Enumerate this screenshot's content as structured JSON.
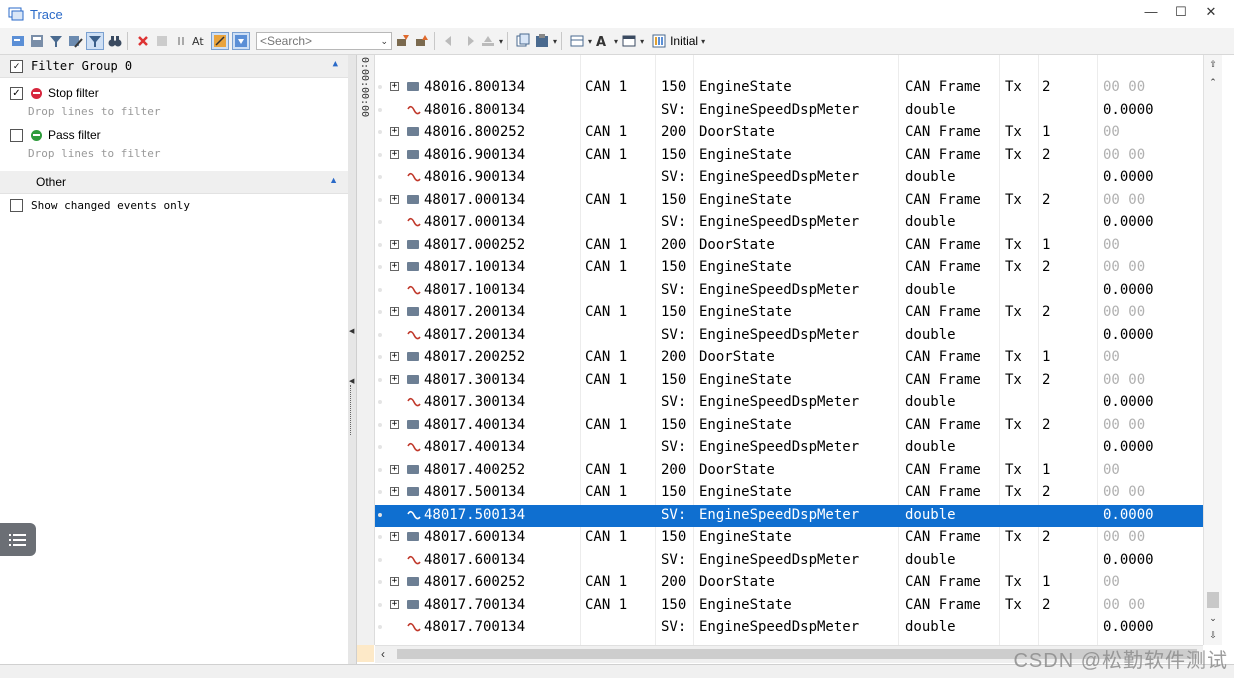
{
  "window": {
    "title": "Trace",
    "controls": [
      "—",
      "☐",
      "✕"
    ]
  },
  "toolbar": {
    "search_placeholder": "<Search>",
    "initial_label": "Initial"
  },
  "filter_panel": {
    "group_header": "Filter Group 0",
    "stop_filter_label": "Stop filter",
    "stop_drop_text": "Drop lines to filter",
    "pass_filter_label": "Pass filter",
    "pass_drop_text": "Drop lines to filter",
    "other_header": "Other",
    "show_changed_label": "Show changed events only"
  },
  "time_column_label": "0:00:00:00",
  "trace_rows": [
    {
      "kind": "frame",
      "time": "48016.800134",
      "chan": "CAN 1",
      "id": "150",
      "name": "EngineState",
      "type": "CAN Frame",
      "dir": "Tx",
      "dlc": "2",
      "data": "00 00"
    },
    {
      "kind": "signal",
      "time": "48016.800134",
      "chan": "",
      "id": "SV:",
      "name": "EngineSpeedDspMeter",
      "type": "double",
      "dir": "",
      "dlc": "",
      "data": "0.0000"
    },
    {
      "kind": "frame",
      "time": "48016.800252",
      "chan": "CAN 1",
      "id": "200",
      "name": "DoorState",
      "type": "CAN Frame",
      "dir": "Tx",
      "dlc": "1",
      "data": "00"
    },
    {
      "kind": "frame",
      "time": "48016.900134",
      "chan": "CAN 1",
      "id": "150",
      "name": "EngineState",
      "type": "CAN Frame",
      "dir": "Tx",
      "dlc": "2",
      "data": "00 00"
    },
    {
      "kind": "signal",
      "time": "48016.900134",
      "chan": "",
      "id": "SV:",
      "name": "EngineSpeedDspMeter",
      "type": "double",
      "dir": "",
      "dlc": "",
      "data": "0.0000"
    },
    {
      "kind": "frame",
      "time": "48017.000134",
      "chan": "CAN 1",
      "id": "150",
      "name": "EngineState",
      "type": "CAN Frame",
      "dir": "Tx",
      "dlc": "2",
      "data": "00 00"
    },
    {
      "kind": "signal",
      "time": "48017.000134",
      "chan": "",
      "id": "SV:",
      "name": "EngineSpeedDspMeter",
      "type": "double",
      "dir": "",
      "dlc": "",
      "data": "0.0000"
    },
    {
      "kind": "frame",
      "time": "48017.000252",
      "chan": "CAN 1",
      "id": "200",
      "name": "DoorState",
      "type": "CAN Frame",
      "dir": "Tx",
      "dlc": "1",
      "data": "00"
    },
    {
      "kind": "frame",
      "time": "48017.100134",
      "chan": "CAN 1",
      "id": "150",
      "name": "EngineState",
      "type": "CAN Frame",
      "dir": "Tx",
      "dlc": "2",
      "data": "00 00"
    },
    {
      "kind": "signal",
      "time": "48017.100134",
      "chan": "",
      "id": "SV:",
      "name": "EngineSpeedDspMeter",
      "type": "double",
      "dir": "",
      "dlc": "",
      "data": "0.0000"
    },
    {
      "kind": "frame",
      "time": "48017.200134",
      "chan": "CAN 1",
      "id": "150",
      "name": "EngineState",
      "type": "CAN Frame",
      "dir": "Tx",
      "dlc": "2",
      "data": "00 00"
    },
    {
      "kind": "signal",
      "time": "48017.200134",
      "chan": "",
      "id": "SV:",
      "name": "EngineSpeedDspMeter",
      "type": "double",
      "dir": "",
      "dlc": "",
      "data": "0.0000"
    },
    {
      "kind": "frame",
      "time": "48017.200252",
      "chan": "CAN 1",
      "id": "200",
      "name": "DoorState",
      "type": "CAN Frame",
      "dir": "Tx",
      "dlc": "1",
      "data": "00"
    },
    {
      "kind": "frame",
      "time": "48017.300134",
      "chan": "CAN 1",
      "id": "150",
      "name": "EngineState",
      "type": "CAN Frame",
      "dir": "Tx",
      "dlc": "2",
      "data": "00 00"
    },
    {
      "kind": "signal",
      "time": "48017.300134",
      "chan": "",
      "id": "SV:",
      "name": "EngineSpeedDspMeter",
      "type": "double",
      "dir": "",
      "dlc": "",
      "data": "0.0000"
    },
    {
      "kind": "frame",
      "time": "48017.400134",
      "chan": "CAN 1",
      "id": "150",
      "name": "EngineState",
      "type": "CAN Frame",
      "dir": "Tx",
      "dlc": "2",
      "data": "00 00"
    },
    {
      "kind": "signal",
      "time": "48017.400134",
      "chan": "",
      "id": "SV:",
      "name": "EngineSpeedDspMeter",
      "type": "double",
      "dir": "",
      "dlc": "",
      "data": "0.0000"
    },
    {
      "kind": "frame",
      "time": "48017.400252",
      "chan": "CAN 1",
      "id": "200",
      "name": "DoorState",
      "type": "CAN Frame",
      "dir": "Tx",
      "dlc": "1",
      "data": "00"
    },
    {
      "kind": "frame",
      "time": "48017.500134",
      "chan": "CAN 1",
      "id": "150",
      "name": "EngineState",
      "type": "CAN Frame",
      "dir": "Tx",
      "dlc": "2",
      "data": "00 00"
    },
    {
      "kind": "signal",
      "time": "48017.500134",
      "chan": "",
      "id": "SV:",
      "name": "EngineSpeedDspMeter",
      "type": "double",
      "dir": "",
      "dlc": "",
      "data": "0.0000",
      "selected": true
    },
    {
      "kind": "frame",
      "time": "48017.600134",
      "chan": "CAN 1",
      "id": "150",
      "name": "EngineState",
      "type": "CAN Frame",
      "dir": "Tx",
      "dlc": "2",
      "data": "00 00"
    },
    {
      "kind": "signal",
      "time": "48017.600134",
      "chan": "",
      "id": "SV:",
      "name": "EngineSpeedDspMeter",
      "type": "double",
      "dir": "",
      "dlc": "",
      "data": "0.0000"
    },
    {
      "kind": "frame",
      "time": "48017.600252",
      "chan": "CAN 1",
      "id": "200",
      "name": "DoorState",
      "type": "CAN Frame",
      "dir": "Tx",
      "dlc": "1",
      "data": "00"
    },
    {
      "kind": "frame",
      "time": "48017.700134",
      "chan": "CAN 1",
      "id": "150",
      "name": "EngineState",
      "type": "CAN Frame",
      "dir": "Tx",
      "dlc": "2",
      "data": "00 00"
    },
    {
      "kind": "signal",
      "time": "48017.700134",
      "chan": "",
      "id": "SV:",
      "name": "EngineSpeedDspMeter",
      "type": "double",
      "dir": "",
      "dlc": "",
      "data": "0.0000"
    }
  ],
  "watermark": "CSDN @松勤软件测试",
  "colors": {
    "selection": "#0f6fd0",
    "title": "#2a6ac8",
    "signal_icon": "#c0392b"
  }
}
